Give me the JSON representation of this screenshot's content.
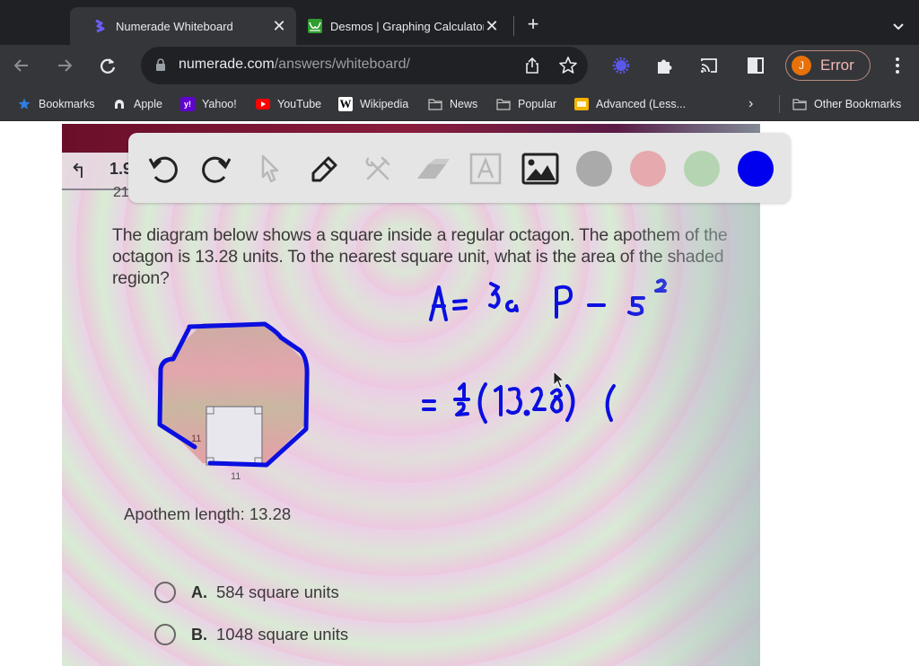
{
  "browser": {
    "tabs": [
      {
        "title": "Numerade Whiteboard",
        "active": true,
        "favicon": "numerade-logo-icon"
      },
      {
        "title": "Desmos | Graphing Calculator",
        "active": false,
        "favicon": "desmos-logo-icon"
      }
    ],
    "new_tab_label": "+",
    "address": {
      "host": "numerade.com",
      "path": "/answers/whiteboard/"
    },
    "profile": {
      "initial": "J",
      "label": "Error"
    },
    "bookmarks": [
      {
        "label": "Bookmarks",
        "icon": "star-icon"
      },
      {
        "label": "Apple",
        "icon": "apple-icon"
      },
      {
        "label": "Yahoo!",
        "icon": "yahoo-icon"
      },
      {
        "label": "YouTube",
        "icon": "youtube-icon"
      },
      {
        "label": "Wikipedia",
        "icon": "wikipedia-icon"
      },
      {
        "label": "News",
        "icon": "folder-icon"
      },
      {
        "label": "Popular",
        "icon": "folder-icon"
      },
      {
        "label": "Advanced (Less...",
        "icon": "slides-icon"
      }
    ],
    "other_bookmarks": "Other Bookmarks"
  },
  "whiteboard": {
    "tools": [
      "undo",
      "redo",
      "select",
      "pen",
      "tools",
      "eraser",
      "text",
      "image"
    ],
    "colors": [
      {
        "name": "gray",
        "hex": "#aaaaaa"
      },
      {
        "name": "pink",
        "hex": "#e6a9ae"
      },
      {
        "name": "green",
        "hex": "#b5d4b1"
      },
      {
        "name": "blue",
        "hex": "#0000ee",
        "selected": true
      }
    ]
  },
  "photo": {
    "question_number": "1.9",
    "sub_number": "21",
    "question_text": "The diagram below shows a square inside a regular octagon. The apothem of the octagon is 13.28 units. To the nearest square unit, what is the area of the shaded region?",
    "square_side_left": "11",
    "square_side_bottom": "11",
    "apothem_label": "Apothem length: 13.28",
    "options": [
      {
        "letter": "A.",
        "text": "584 square units"
      },
      {
        "letter": "B.",
        "text": "1048 square units"
      }
    ]
  },
  "handwriting": {
    "line1": "A = ½ a P − s²",
    "line2": "= ½ (13.28)("
  }
}
